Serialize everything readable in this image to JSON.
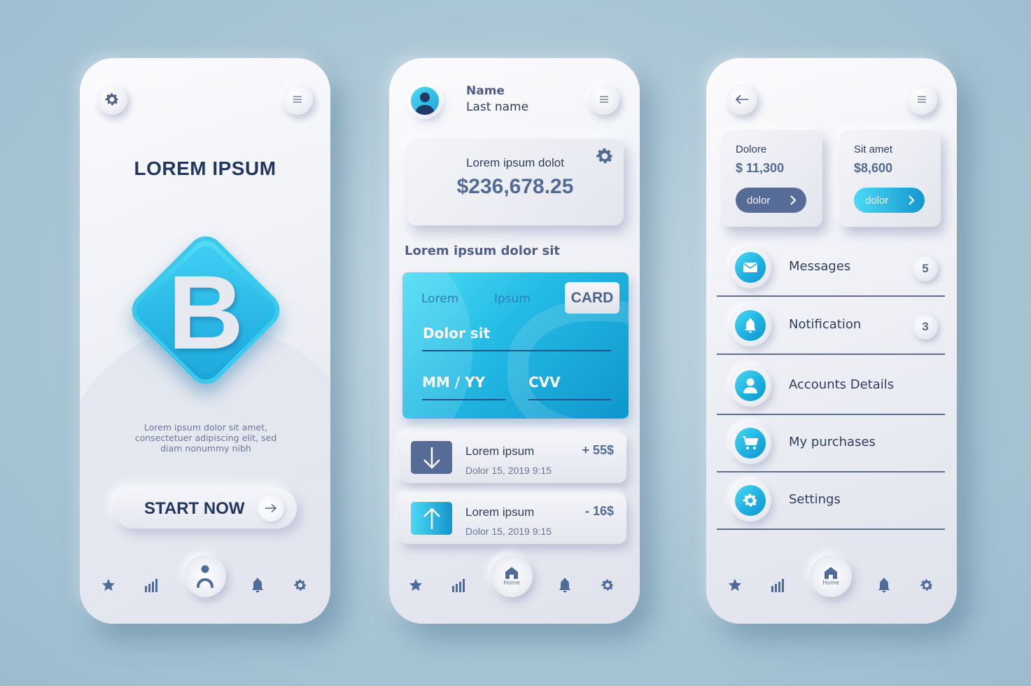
{
  "colors": {
    "background": "#aac6d6",
    "primary_text": "#22375e",
    "accent_cyan": "#22b9e3",
    "accent_slate": "#536a93",
    "icon_slate": "#4f6288"
  },
  "screen1": {
    "settings_icon": "gear-icon",
    "menu_icon": "hamburger-icon",
    "title": "LOREM IPSUM",
    "logo_letter": "B",
    "description_lines": [
      "Lorem ipsum dolor sit amet,",
      "consectetuer adipiscing elit, sed",
      "diam nonummy nibh"
    ],
    "start_button": "START NOW",
    "start_arrow_icon": "arrow-right-icon",
    "nav": {
      "items": [
        "star-icon",
        "bar-chart-icon",
        "user-icon",
        "bell-icon",
        "gear-icon"
      ],
      "active": "user-icon"
    }
  },
  "screen2": {
    "profile": {
      "avatar_icon": "user-avatar-icon",
      "name": "Name",
      "last_name": "Last name"
    },
    "menu_icon": "hamburger-icon",
    "balance": {
      "label": "Lorem ipsum dolot",
      "amount": "$236,678.25",
      "settings_icon": "gear-icon"
    },
    "section_title": "Lorem ipsum dolor sit",
    "card": {
      "label_left": "Lorem",
      "label_mid": "Ipsum",
      "badge": "CARD",
      "holder_placeholder": "Dolor sit",
      "expiry_placeholder": "MM / YY",
      "cvv_placeholder": "CVV"
    },
    "transactions": [
      {
        "icon": "arrow-down-icon",
        "title": "Lorem ipsum",
        "date": "Dolor 15, 2019 9:15",
        "amount": "+ 55$",
        "icon_color": "#566c97"
      },
      {
        "icon": "arrow-up-icon",
        "title": "Lorem ipsum",
        "date": "Dolor 15, 2019 9:15",
        "amount": "- 16$",
        "icon_color": "#22b9e3"
      }
    ],
    "nav": {
      "items": [
        "star-icon",
        "bar-chart-icon",
        "home-icon",
        "bell-icon",
        "gear-icon"
      ],
      "active": "home-icon",
      "active_label": "Home"
    }
  },
  "screen3": {
    "back_icon": "arrow-left-icon",
    "menu_icon": "hamburger-icon",
    "cards": [
      {
        "label": "Dolore",
        "amount": "$ 11,300",
        "button": "dolor",
        "button_color": "#566c97"
      },
      {
        "label": "Sit amet",
        "amount": "$8,600",
        "button": "dolor",
        "button_color": "#22b9e3"
      }
    ],
    "menu": [
      {
        "icon": "envelope-icon",
        "label": "Messages",
        "badge": "5"
      },
      {
        "icon": "bell-icon",
        "label": "Notification",
        "badge": "3"
      },
      {
        "icon": "user-icon",
        "label": "Accounts Details",
        "badge": null
      },
      {
        "icon": "cart-icon",
        "label": "My purchases",
        "badge": null
      },
      {
        "icon": "gear-icon",
        "label": "Settings",
        "badge": null
      }
    ],
    "nav": {
      "items": [
        "star-icon",
        "bar-chart-icon",
        "home-icon",
        "bell-icon",
        "gear-icon"
      ],
      "active": "home-icon",
      "active_label": "Home"
    }
  }
}
